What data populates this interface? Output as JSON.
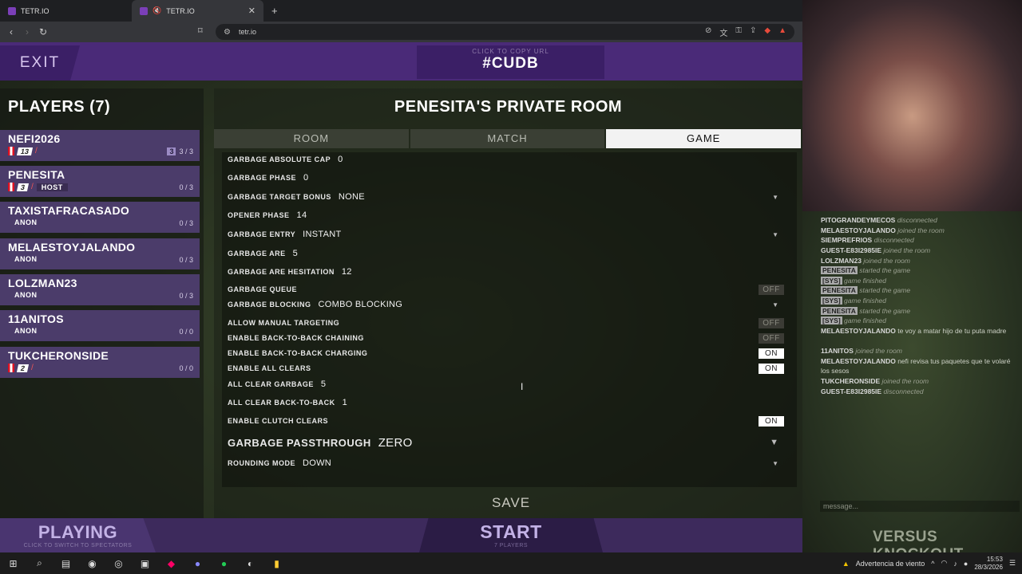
{
  "browser": {
    "tabs": [
      {
        "title": "TETR.IO"
      },
      {
        "title": "TETR.IO"
      }
    ],
    "url": "tetr.io",
    "new_tab": "+"
  },
  "game": {
    "exit": "EXIT",
    "room_hint": "CLICK TO COPY URL",
    "room_code": "#CUDB",
    "players_header": "PLAYERS (7)",
    "players": [
      {
        "name": "NEFI2026",
        "level": "13",
        "tag": "",
        "score": "3 / 3",
        "badge": "3",
        "flag": true
      },
      {
        "name": "PENESITA",
        "level": "3",
        "tag": "HOST",
        "score": "0 / 3",
        "flag": true
      },
      {
        "name": "TAXISTAFRACASADO",
        "level": "",
        "tag": "ANON",
        "score": "0 / 3",
        "flag": false
      },
      {
        "name": "MELAESTOYJALANDO",
        "level": "",
        "tag": "ANON",
        "score": "0 / 3",
        "flag": false
      },
      {
        "name": "LOLZMAN23",
        "level": "",
        "tag": "ANON",
        "score": "0 / 3",
        "flag": false
      },
      {
        "name": "11ANITOS",
        "level": "",
        "tag": "ANON",
        "score": "0 / 0",
        "flag": false
      },
      {
        "name": "TUKCHERONSIDE",
        "level": "2",
        "tag": "",
        "score": "0 / 0",
        "flag": true
      }
    ],
    "room_title": "PENESITA'S PRIVATE ROOM",
    "tabs": [
      "ROOM",
      "MATCH",
      "GAME"
    ],
    "active_tab": "GAME",
    "settings": [
      {
        "label": "GARBAGE ABSOLUTE CAP",
        "value": "0"
      },
      {
        "label": "GARBAGE PHASE",
        "value": "0"
      },
      {
        "label": "GARBAGE TARGET BONUS",
        "value": "NONE",
        "dropdown": true
      },
      {
        "label": "OPENER PHASE",
        "value": "14"
      },
      {
        "label": "GARBAGE ENTRY",
        "value": "INSTANT",
        "dropdown": true
      },
      {
        "label": "GARBAGE ARE",
        "value": "5"
      },
      {
        "label": "GARBAGE ARE HESITATION",
        "value": "12"
      },
      {
        "label": "GARBAGE QUEUE",
        "toggle": "OFF"
      },
      {
        "label": "GARBAGE BLOCKING",
        "value": "COMBO BLOCKING",
        "dropdown": true
      },
      {
        "label": "ALLOW MANUAL TARGETING",
        "toggle": "OFF"
      },
      {
        "label": "ENABLE BACK-TO-BACK CHAINING",
        "toggle": "OFF"
      },
      {
        "label": "ENABLE BACK-TO-BACK CHARGING",
        "toggle": "ON"
      },
      {
        "label": "ENABLE ALL CLEARS",
        "toggle": "ON"
      },
      {
        "label": "ALL CLEAR GARBAGE",
        "value": "5"
      },
      {
        "label": "ALL CLEAR BACK-TO-BACK",
        "value": "1"
      },
      {
        "label": "ENABLE CLUTCH CLEARS",
        "toggle": "ON"
      },
      {
        "label": "GARBAGE PASSTHROUGH",
        "value": "ZERO",
        "dropdown": true,
        "big": true
      },
      {
        "label": "ROUNDING MODE",
        "value": "DOWN",
        "dropdown": true
      }
    ],
    "save": "SAVE",
    "playing": "PLAYING",
    "playing_hint": "CLICK TO SWITCH TO SPECTATORS",
    "start": "START",
    "start_hint": "7 PLAYERS",
    "mode": "VERSUS KNOCKOUT"
  },
  "chat": {
    "messages": [
      {
        "user": "PITOGRANDEYMECOS",
        "text": "disconnected",
        "sys": true
      },
      {
        "user": "MELAESTOYJALANDO",
        "text": "joined the room",
        "sys": true
      },
      {
        "user": "SIEMPREFRIOS",
        "text": "disconnected",
        "sys": true
      },
      {
        "user": "GUEST-E83I2985IE",
        "text": "joined the room",
        "sys": true
      },
      {
        "user": "LOLZMAN23",
        "text": "joined the room",
        "sys": true
      },
      {
        "user": "PENESITA",
        "text": "started the game",
        "sys": true,
        "hl": true
      },
      {
        "user": "[SYS]",
        "text": "game finished",
        "sys": true,
        "hl": true
      },
      {
        "user": "PENESITA",
        "text": "started the game",
        "sys": true,
        "hl": true
      },
      {
        "user": "[SYS]",
        "text": "game finished",
        "sys": true,
        "hl": true
      },
      {
        "user": "PENESITA",
        "text": "started the game",
        "sys": true,
        "hl": true
      },
      {
        "user": "[SYS]",
        "text": "game finished",
        "sys": true,
        "hl": true
      },
      {
        "user": "MELAESTOYJALANDO",
        "text": "te voy a matar hijo de tu puta madre",
        "sys": false
      },
      {
        "user": "11ANITOS",
        "text": "joined the room",
        "sys": true
      },
      {
        "user": "MELAESTOYJALANDO",
        "text": "nefi revisa tus paquetes que te volaré los sesos",
        "sys": false
      },
      {
        "user": "TUKCHERONSIDE",
        "text": "joined the room",
        "sys": true
      },
      {
        "user": "GUEST-E83I2985IE",
        "text": "disconnected",
        "sys": true
      }
    ],
    "placeholder": "message..."
  },
  "taskbar": {
    "weather": "Advertencia de viento",
    "time": "15:53",
    "date": "28/3/2026"
  }
}
